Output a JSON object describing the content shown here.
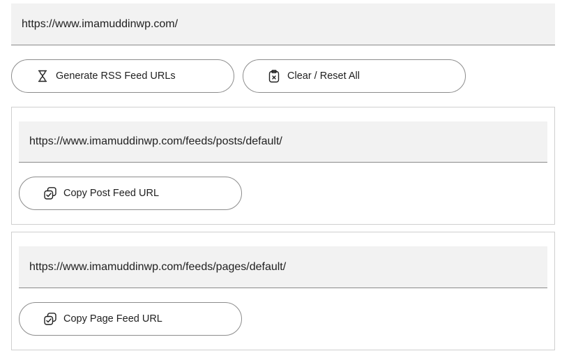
{
  "main_url": {
    "value": "https://www.imamuddinwp.com/",
    "placeholder": ""
  },
  "actions": {
    "generate": {
      "label": "Generate RSS Feed URLs",
      "icon": "hourglass-icon"
    },
    "clear": {
      "label": "Clear / Reset All",
      "icon": "clipboard-x-icon"
    }
  },
  "post_feed": {
    "url": "https://www.imamuddinwp.com/feeds/posts/default/",
    "copy_label": "Copy Post Feed URL",
    "copy_icon": "copy-icon"
  },
  "page_feed": {
    "url": "https://www.imamuddinwp.com/feeds/pages/default/",
    "copy_label": "Copy Page Feed URL",
    "copy_icon": "copy-icon"
  },
  "colors": {
    "input_bg": "#f2f2f2",
    "border": "#8c8c8c",
    "text": "#1f1f1f"
  }
}
